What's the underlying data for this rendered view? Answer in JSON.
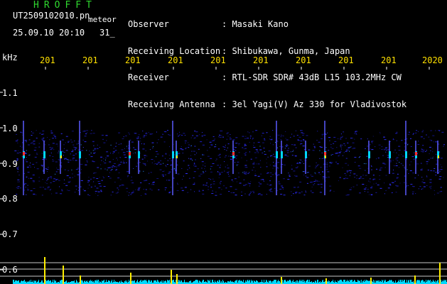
{
  "header": {
    "app_title": "HROFFT",
    "file_name": "UT2509102010.pn",
    "meteor_label": "meteor",
    "timestamp": "25.09.10 20:10",
    "count": "31_"
  },
  "station_info": [
    {
      "label": "Observer",
      "value": ": Masaki Kano"
    },
    {
      "label": "Receiving Location",
      "value": ": Shibukawa, Gunma, Japan"
    },
    {
      "label": "Receiver",
      "value": ": RTL-SDR SDR# 43dB L15 103.2MHz CW"
    },
    {
      "label": "Receiving Antenna",
      "value": ": 3el Yagi(V) Az 330 for Vladivostok"
    }
  ],
  "axis": {
    "unit": "kHz",
    "y_ticks": [
      "1.1",
      "1.0",
      "0.9",
      "0.8",
      "0.7",
      "0.6"
    ],
    "x_ticks": [
      "201",
      "201",
      "201",
      "201",
      "201",
      "201",
      "201",
      "201",
      "201",
      "2020"
    ]
  },
  "colors": {
    "background": "#000000",
    "title_green": "#2fd82f",
    "tick_yellow": "#ffe000",
    "spectrum_blue": "#1e1ec8",
    "signal_cyan": "#00d8ff",
    "peak_yellow": "#ffee00"
  }
}
